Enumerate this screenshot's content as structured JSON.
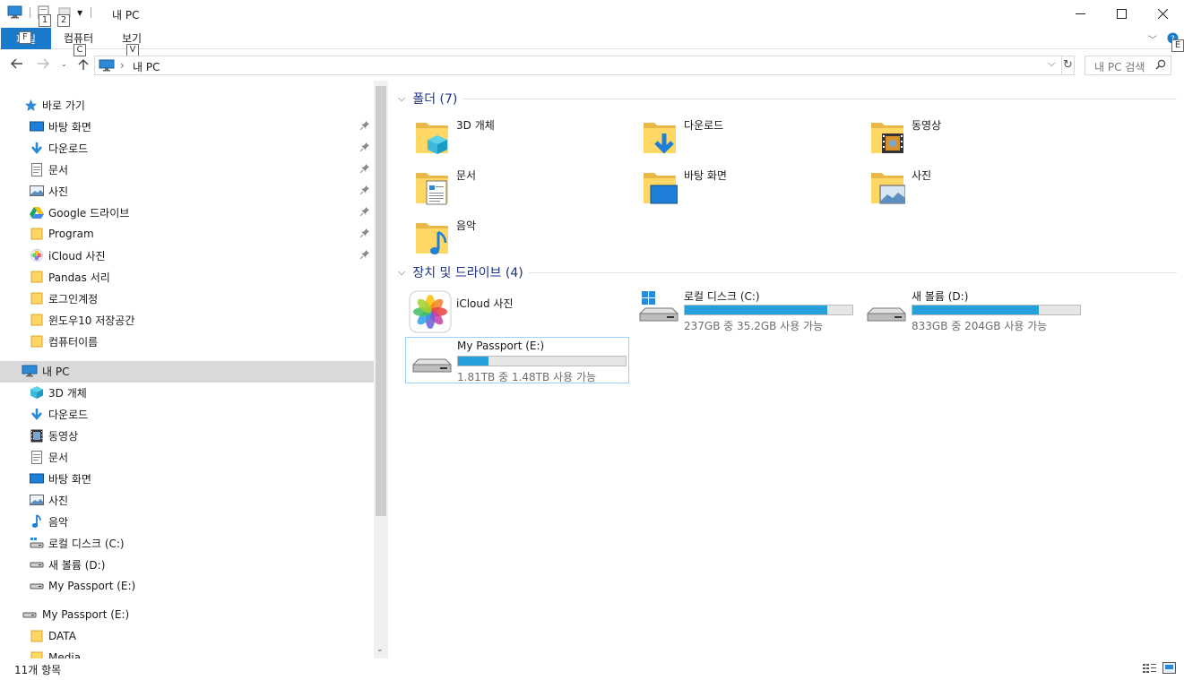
{
  "window": {
    "title": "내 PC",
    "keytips": {
      "qa1": "1",
      "qa2": "2",
      "file": "F",
      "computer": "C",
      "view": "V",
      "help": "E"
    }
  },
  "ribbon": {
    "file_label": "파일",
    "tabs": [
      "컴퓨터",
      "보기"
    ]
  },
  "address": {
    "crumb": "내 PC",
    "search_placeholder": "내 PC 검색"
  },
  "nav": {
    "quick_access": "바로 가기",
    "quick_items": [
      {
        "label": "바탕 화면",
        "icon": "desktop-icon",
        "pinned": true
      },
      {
        "label": "다운로드",
        "icon": "download-icon",
        "pinned": true
      },
      {
        "label": "문서",
        "icon": "document-icon",
        "pinned": true
      },
      {
        "label": "사진",
        "icon": "picture-icon",
        "pinned": true
      },
      {
        "label": "Google 드라이브",
        "icon": "google-drive-icon",
        "pinned": true
      },
      {
        "label": "Program",
        "icon": "folder-icon",
        "pinned": true
      },
      {
        "label": "iCloud 사진",
        "icon": "icloud-photos-icon",
        "pinned": true
      },
      {
        "label": "Pandas 서리",
        "icon": "folder-icon",
        "pinned": false
      },
      {
        "label": "로그인계정",
        "icon": "folder-icon",
        "pinned": false
      },
      {
        "label": "윈도우10 저장공간",
        "icon": "folder-icon",
        "pinned": false
      },
      {
        "label": "컴퓨터이름",
        "icon": "folder-icon",
        "pinned": false
      }
    ],
    "this_pc": "내 PC",
    "pc_items": [
      {
        "label": "3D 개체",
        "icon": "3d-objects-icon"
      },
      {
        "label": "다운로드",
        "icon": "download-icon"
      },
      {
        "label": "동영상",
        "icon": "video-icon"
      },
      {
        "label": "문서",
        "icon": "document-icon"
      },
      {
        "label": "바탕 화면",
        "icon": "desktop-icon"
      },
      {
        "label": "사진",
        "icon": "picture-icon"
      },
      {
        "label": "음악",
        "icon": "music-icon"
      },
      {
        "label": "로컬 디스크 (C:)",
        "icon": "local-disk-icon"
      },
      {
        "label": "새 볼륨 (D:)",
        "icon": "drive-icon"
      },
      {
        "label": "My Passport (E:)",
        "icon": "drive-icon"
      }
    ],
    "passport": "My Passport (E:)",
    "passport_items": [
      "DATA",
      "Media"
    ]
  },
  "main": {
    "folders_header": "폴더 (7)",
    "folders": [
      {
        "label": "3D 개체",
        "overlay": "3d-cube-icon"
      },
      {
        "label": "다운로드",
        "overlay": "download-arrow-icon"
      },
      {
        "label": "동영상",
        "overlay": "film-icon"
      },
      {
        "label": "문서",
        "overlay": "document-page-icon"
      },
      {
        "label": "바탕 화면",
        "overlay": "desktop-screen-icon"
      },
      {
        "label": "사진",
        "overlay": "landscape-icon"
      },
      {
        "label": "음악",
        "overlay": "music-note-icon"
      }
    ],
    "devices_header": "장치 및 드라이브 (4)",
    "drives": [
      {
        "label": "iCloud 사진",
        "info": "",
        "used_fraction": null
      },
      {
        "label": "로컬 디스크 (C:)",
        "info": "237GB 중 35.2GB 사용 가능",
        "used_fraction": 0.85
      },
      {
        "label": "새 볼륨 (D:)",
        "info": "833GB 중 204GB 사용 가능",
        "used_fraction": 0.755
      },
      {
        "label": "My Passport (E:)",
        "info": "1.81TB 중 1.48TB 사용 가능",
        "used_fraction": 0.18
      }
    ]
  },
  "status": {
    "count": "11개 항목"
  },
  "colors": {
    "accent": "#1979ca",
    "progress": "#26a0da",
    "header": "#1e3287",
    "selection": "#d9d9d9"
  }
}
